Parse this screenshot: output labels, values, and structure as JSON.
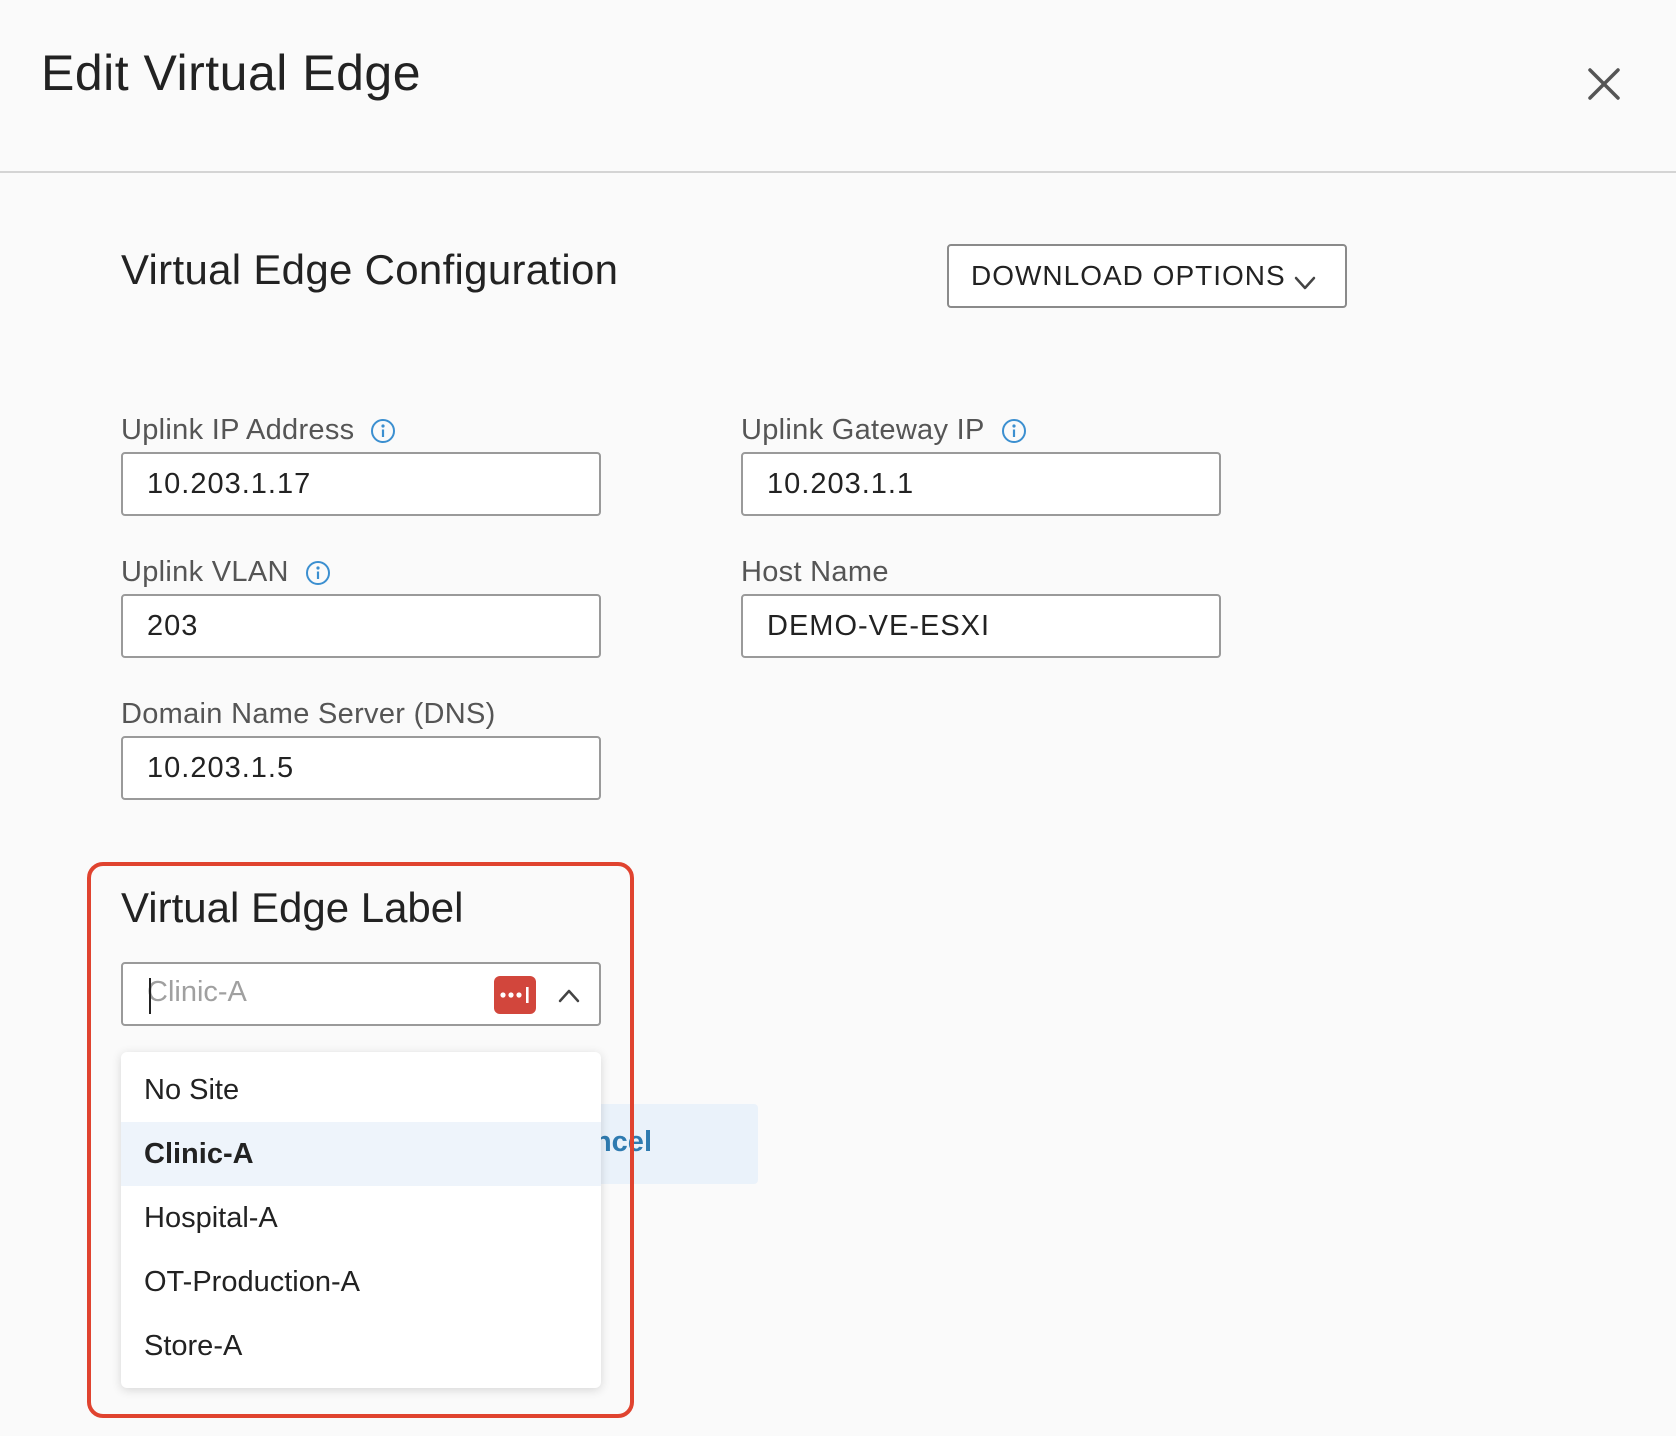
{
  "header": {
    "title": "Edit Virtual Edge"
  },
  "config": {
    "title": "Virtual Edge Configuration",
    "download_label": "DOWNLOAD OPTIONS"
  },
  "fields": {
    "uplink_ip": {
      "label": "Uplink IP Address",
      "value": "10.203.1.17"
    },
    "uplink_gateway": {
      "label": "Uplink Gateway IP",
      "value": "10.203.1.1"
    },
    "uplink_vlan": {
      "label": "Uplink VLAN",
      "value": "203"
    },
    "host_name": {
      "label": "Host Name",
      "value": "DEMO-VE-ESXI"
    },
    "dns": {
      "label": "Domain Name Server (DNS)",
      "value": "10.203.1.5"
    }
  },
  "label_section": {
    "title": "Virtual Edge Label",
    "placeholder": "Clinic-A",
    "options": [
      "No Site",
      "Clinic-A",
      "Hospital-A",
      "OT-Production-A",
      "Store-A"
    ],
    "selected": "Clinic-A"
  },
  "actions": {
    "cancel_visible_text": "ncel"
  },
  "colors": {
    "highlight": "#e0432f",
    "info_icon": "#3b8fd0",
    "cancel_text": "#2f7bb0",
    "password_icon": "#d2463c"
  }
}
